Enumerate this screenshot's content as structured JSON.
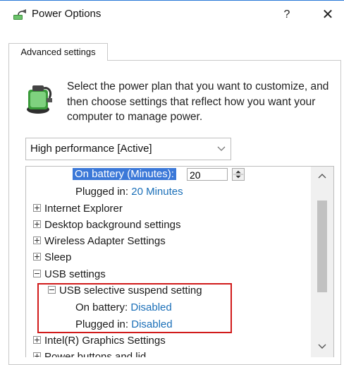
{
  "window": {
    "title": "Power Options",
    "help_label": "?",
    "close_label": "✕"
  },
  "tab": {
    "label": "Advanced settings"
  },
  "description": "Select the power plan that you want to customize, and then choose settings that reflect how you want your computer to manage power.",
  "plan_dropdown": {
    "value": "High performance [Active]"
  },
  "tree": {
    "on_battery_label": "On battery (Minutes):",
    "on_battery_value": "20",
    "plugged_in_label": "Plugged in:",
    "plugged_in_value": "20 Minutes",
    "items": [
      "Internet Explorer",
      "Desktop background settings",
      "Wireless Adapter Settings",
      "Sleep",
      "USB settings",
      "USB selective suspend setting",
      "Intel(R) Graphics Settings",
      "Power buttons and lid"
    ],
    "usb_on_battery_label": "On battery:",
    "usb_on_battery_value": "Disabled",
    "usb_plugged_in_label": "Plugged in:",
    "usb_plugged_in_value": "Disabled"
  },
  "colors": {
    "accent": "#3b78d8",
    "link": "#1a6fb8",
    "highlight_box": "#d11b1b"
  },
  "icons": [
    "power-options-icon",
    "battery-plug-icon",
    "chevron-down-icon",
    "expand-plus-icon",
    "collapse-minus-icon",
    "spin-arrows-icon",
    "scroll-up-icon",
    "scroll-down-icon"
  ]
}
